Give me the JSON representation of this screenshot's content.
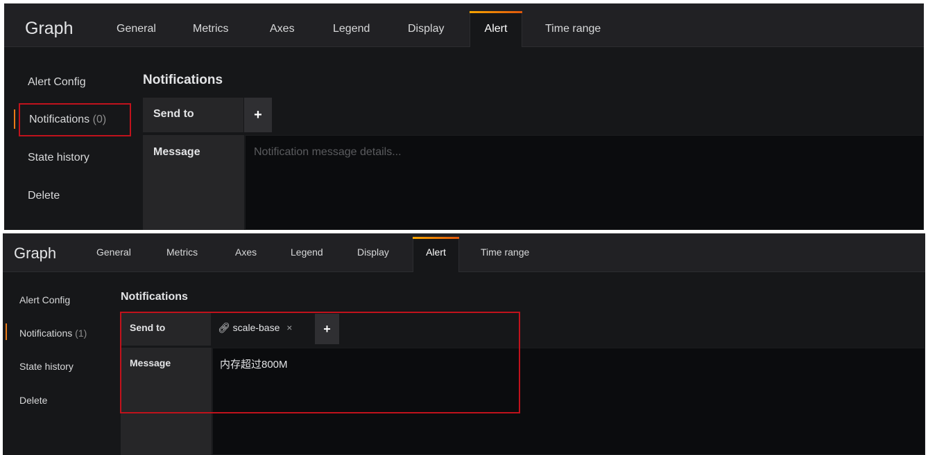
{
  "panels": [
    {
      "title": "Graph",
      "tabs": [
        "General",
        "Metrics",
        "Axes",
        "Legend",
        "Display",
        "Alert",
        "Time range"
      ],
      "active_tab": "Alert",
      "sidebar": {
        "alert_config": "Alert Config",
        "notifications": "Notifications",
        "notifications_count": "(0)",
        "state_history": "State history",
        "delete": "Delete"
      },
      "section_title": "Notifications",
      "send_to_label": "Send to",
      "add_label": "+",
      "message_label": "Message",
      "message_placeholder": "Notification message details...",
      "message_value": ""
    },
    {
      "title": "Graph",
      "tabs": [
        "General",
        "Metrics",
        "Axes",
        "Legend",
        "Display",
        "Alert",
        "Time range"
      ],
      "active_tab": "Alert",
      "sidebar": {
        "alert_config": "Alert Config",
        "notifications": "Notifications",
        "notifications_count": "(1)",
        "state_history": "State history",
        "delete": "Delete"
      },
      "section_title": "Notifications",
      "send_to_label": "Send to",
      "notification_channel": "scale-base",
      "channel_icon": "notification-channel-icon",
      "remove_label": "×",
      "add_label": "+",
      "message_label": "Message",
      "message_value": "内存超过800M"
    }
  ],
  "colors": {
    "panel_bg": "#161719",
    "tabbar_bg": "#212124",
    "active_accent": "#eb7b18",
    "highlight_border": "#c1121c"
  }
}
